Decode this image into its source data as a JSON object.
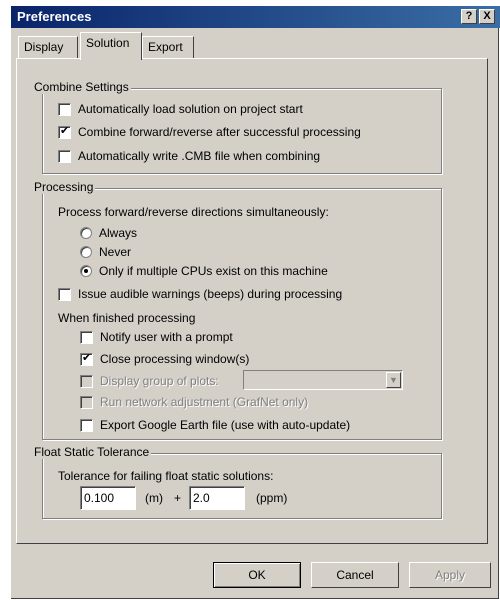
{
  "window": {
    "title": "Preferences",
    "help_label": "?",
    "close_label": "X"
  },
  "tabs": [
    {
      "label": "Display"
    },
    {
      "label": "Solution"
    },
    {
      "label": "Export"
    }
  ],
  "combine": {
    "legend": "Combine Settings",
    "items": [
      {
        "label": "Automatically load solution on project start",
        "checked": false
      },
      {
        "label": "Combine forward/reverse after successful processing",
        "checked": true
      },
      {
        "label": "Automatically write .CMB file when combining",
        "checked": false
      }
    ]
  },
  "processing": {
    "legend": "Processing",
    "directions_label": "Process forward/reverse directions simultaneously:",
    "radios": [
      {
        "label": "Always",
        "checked": false
      },
      {
        "label": "Never",
        "checked": false
      },
      {
        "label": "Only if multiple CPUs exist on this machine",
        "checked": true
      }
    ],
    "audible_label": "Issue audible warnings (beeps) during processing",
    "finished_label": "When finished processing",
    "finished_items": [
      {
        "label": "Notify user with a prompt",
        "checked": false
      },
      {
        "label": "Close processing window(s)",
        "checked": true
      },
      {
        "label": "Display group of plots:",
        "checked": false,
        "disabled": true
      },
      {
        "label": "Run network adjustment (GrafNet only)",
        "checked": false,
        "disabled": true
      },
      {
        "label": "Export Google Earth file (use with auto-update)",
        "checked": false
      }
    ],
    "plots_value": ""
  },
  "float": {
    "legend": "Float Static Tolerance",
    "label": "Tolerance for failing float static solutions:",
    "value_m": "0.100",
    "unit_m": "(m)",
    "plus": "+",
    "value_ppm": "2.0",
    "unit_ppm": "(ppm)"
  },
  "buttons": {
    "ok": "OK",
    "cancel": "Cancel",
    "apply": "Apply"
  }
}
